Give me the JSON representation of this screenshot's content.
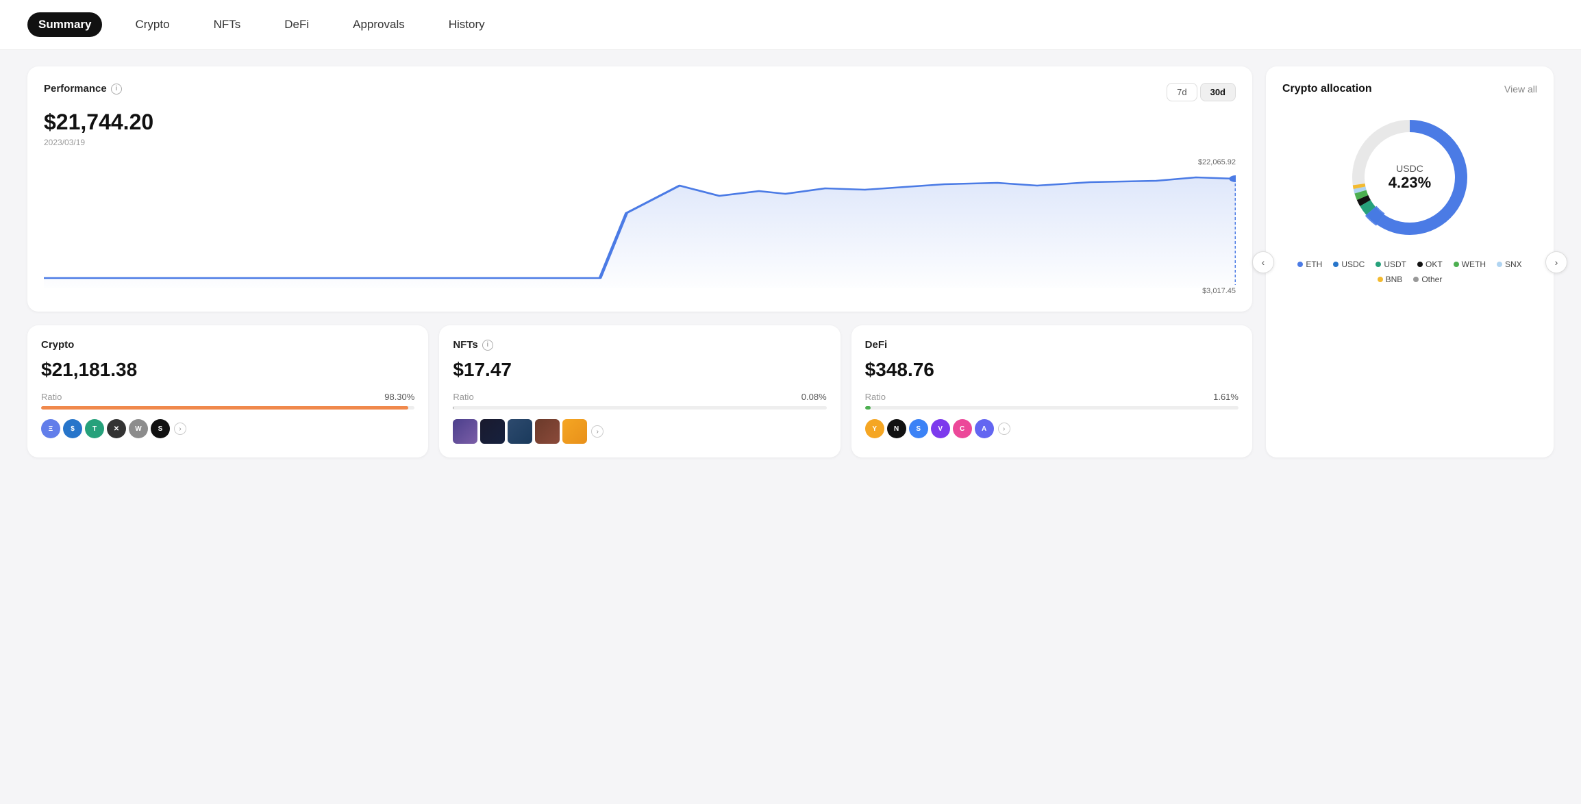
{
  "nav": {
    "items": [
      {
        "id": "summary",
        "label": "Summary",
        "active": true
      },
      {
        "id": "crypto",
        "label": "Crypto",
        "active": false
      },
      {
        "id": "nfts",
        "label": "NFTs",
        "active": false
      },
      {
        "id": "defi",
        "label": "DeFi",
        "active": false
      },
      {
        "id": "approvals",
        "label": "Approvals",
        "active": false
      },
      {
        "id": "history",
        "label": "History",
        "active": false
      }
    ]
  },
  "performance": {
    "title": "Performance",
    "value": "$21,744.20",
    "date": "2023/03/19",
    "time_7d": "7d",
    "time_30d": "30d",
    "chart_high": "$22,065.92",
    "chart_low": "$3,017.45"
  },
  "allocation": {
    "title": "Crypto allocation",
    "view_all": "View all",
    "center_label": "USDC",
    "center_percent": "4.23%",
    "legend": [
      {
        "label": "ETH",
        "color": "#4B7BE5"
      },
      {
        "label": "USDC",
        "color": "#2775CA"
      },
      {
        "label": "USDT",
        "color": "#26A17B"
      },
      {
        "label": "OKT",
        "color": "#111111"
      },
      {
        "label": "WETH",
        "color": "#4CAF50"
      },
      {
        "label": "SNX",
        "color": "#b0d4f1"
      },
      {
        "label": "BNB",
        "color": "#F3BA2F"
      },
      {
        "label": "Other",
        "color": "#999999"
      }
    ],
    "arrow_left": "‹",
    "arrow_right": "›"
  },
  "crypto_card": {
    "title": "Crypto",
    "value": "$21,181.38",
    "ratio_label": "Ratio",
    "ratio_value": "98.30%",
    "progress": 98.3,
    "progress_color": "#F0894C",
    "tokens": [
      {
        "color": "#627EEA",
        "letter": "Ξ"
      },
      {
        "color": "#2775CA",
        "letter": "$"
      },
      {
        "color": "#26A17B",
        "letter": "T"
      },
      {
        "color": "#333",
        "letter": "✕"
      },
      {
        "color": "#8C8C8C",
        "letter": "W"
      },
      {
        "color": "#111",
        "letter": "S"
      }
    ],
    "chevron": "›"
  },
  "nfts_card": {
    "title": "NFTs",
    "has_info": true,
    "value": "$17.47",
    "ratio_label": "Ratio",
    "ratio_value": "0.08%",
    "progress": 0.08,
    "progress_color": "#888888",
    "chevron": "›"
  },
  "defi_card": {
    "title": "DeFi",
    "value": "$348.76",
    "ratio_label": "Ratio",
    "ratio_value": "1.61%",
    "progress": 1.61,
    "progress_color": "#4CAF50",
    "tokens": [
      {
        "color": "#F5A623",
        "letter": "Y"
      },
      {
        "color": "#111",
        "letter": "N"
      },
      {
        "color": "#3B82F6",
        "letter": "S"
      },
      {
        "color": "#7C3AED",
        "letter": "V"
      },
      {
        "color": "#EC4899",
        "letter": "C"
      },
      {
        "color": "#6366F1",
        "letter": "A"
      }
    ],
    "chevron": "›"
  }
}
